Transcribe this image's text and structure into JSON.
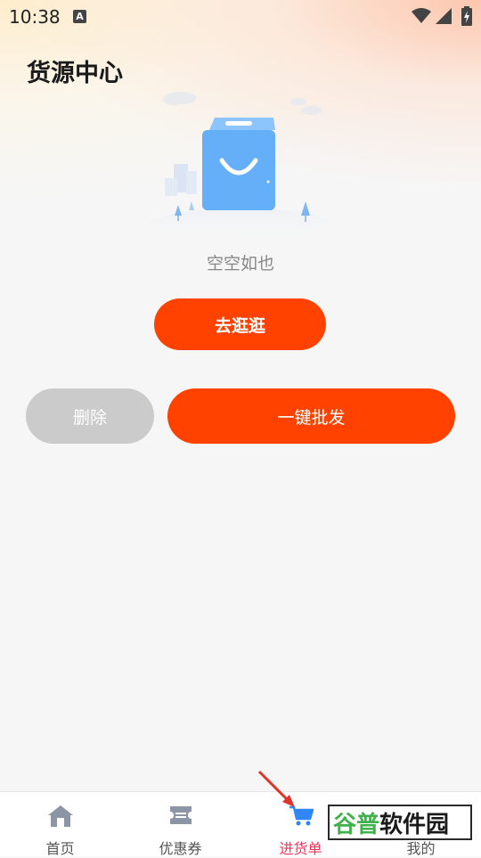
{
  "status_bar": {
    "time": "10:38",
    "notification_letter": "A"
  },
  "header": {
    "title": "货源中心"
  },
  "empty_state": {
    "message": "空空如也"
  },
  "actions": {
    "browse_label": "去逛逛",
    "delete_label": "删除",
    "batch_label": "一键批发"
  },
  "bottom_nav": {
    "items": [
      {
        "label": "首页",
        "icon": "home-icon"
      },
      {
        "label": "优惠券",
        "icon": "coupon-icon"
      },
      {
        "label": "进货单",
        "icon": "cart-icon",
        "active": true
      },
      {
        "label": "我的",
        "icon": "user-icon"
      }
    ]
  },
  "watermark": {
    "text_green": "谷普",
    "text_dark": "软件园"
  },
  "colors": {
    "accent": "#ff4200",
    "active_tab": "#ff2d55",
    "cart_blue": "#2f86f6",
    "disabled": "#cbcbcb"
  }
}
